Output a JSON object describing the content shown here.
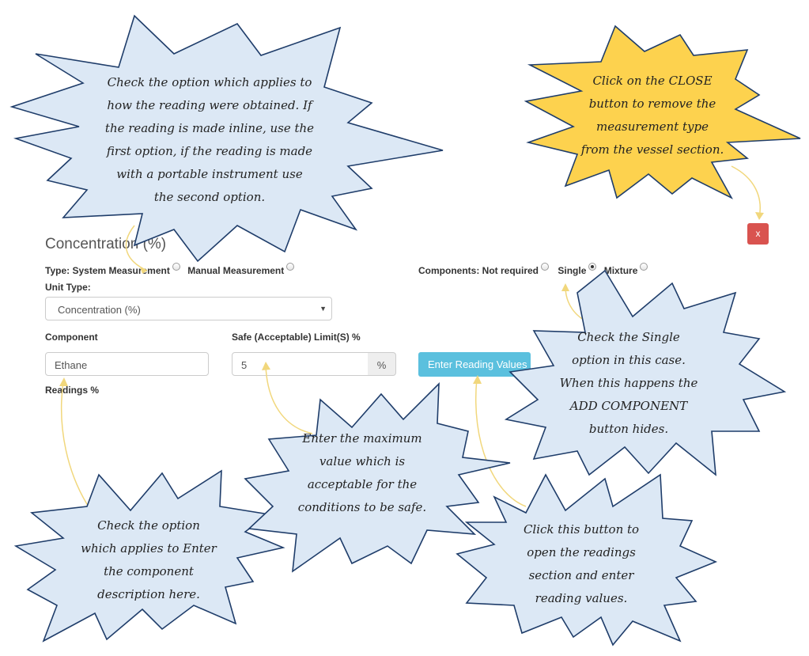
{
  "form": {
    "title": "Concentration (%)",
    "type_label": "Type:",
    "type_options": [
      "System Measurement",
      "Manual Measurement"
    ],
    "components_label": "Components:",
    "component_options": [
      "Not required",
      "Single",
      "Mixture"
    ],
    "selected_component_option": "Single",
    "unit_type_label": "Unit Type:",
    "unit_type_value": "Concentration (%)",
    "component_label": "Component",
    "component_value": "Ethane",
    "safe_limit_label": "Safe (Acceptable) Limit(S) %",
    "safe_limit_value": "5",
    "safe_limit_unit": "%",
    "enter_button_label": "Enter Reading Values",
    "readings_label": "Readings %",
    "close_button_label": "x"
  },
  "callouts": {
    "reading_method": "Check the option which applies to\nhow the reading were obtained. If\nthe reading is made inline, use the\nfirst option, if the reading is made\nwith a portable instrument use\nthe second option.",
    "close": "Click on the CLOSE\nbutton to remove the\nmeasurement type\nfrom the vessel section.",
    "single": "Check the Single\noption in this case.\nWhen this happens the\nADD COMPONENT\nbutton hides.",
    "component": "Check the option\nwhich applies to Enter\nthe component\ndescription here.",
    "max_value": "Enter the maximum\nvalue which is\nacceptable for the\nconditions to be safe.",
    "enter_button": "Click this button to\nopen the readings\nsection and enter\nreading values."
  },
  "colors": {
    "callout_blue": "#dce8f5",
    "callout_orange": "#fdd24e",
    "callout_stroke": "#1f3d6a",
    "arrow": "#f1d77c",
    "info_button": "#5bc0de",
    "close_button": "#d9534f"
  }
}
